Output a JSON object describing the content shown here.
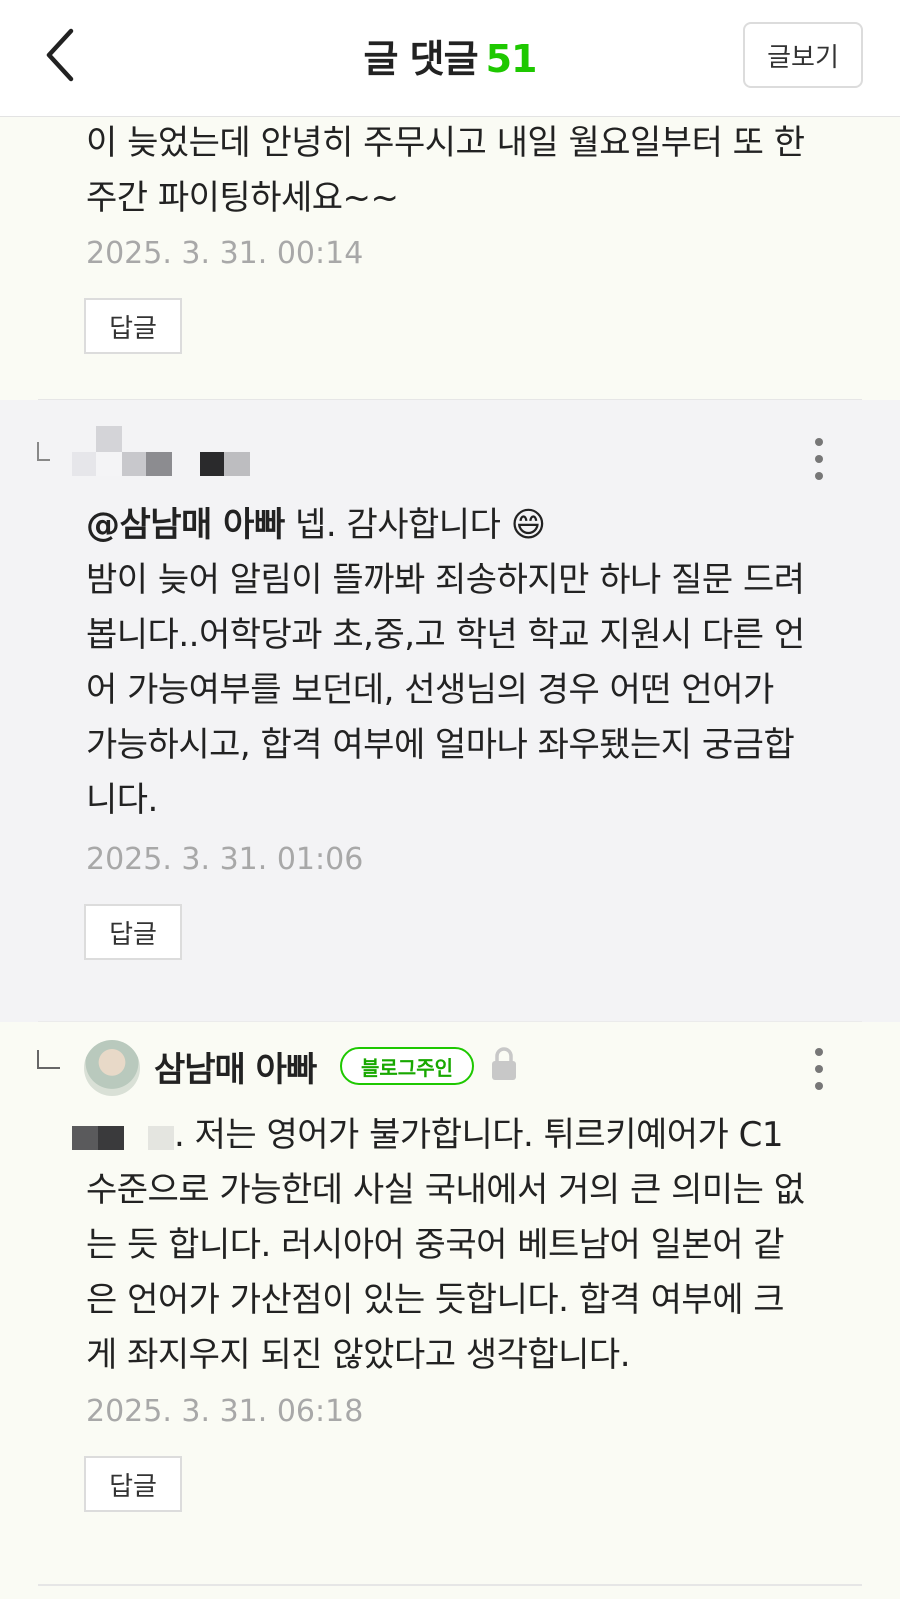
{
  "header": {
    "title": "글 댓글",
    "comment_count": "51",
    "view_post_label": "글보기",
    "accent_color": "#1ec800"
  },
  "comments": [
    {
      "lines": [
        "이 늦었는데 안녕히 주무시고 내일 월요일부터 또 한",
        "주간 파이팅하세요~~"
      ],
      "timestamp": "2025. 3. 31. 00:14",
      "reply_label": "답글"
    },
    {
      "mention": "@삼남매 아빠",
      "first_line_rest": " 넵. 감사합니다 😄",
      "lines": [
        "밤이 늦어 알림이 뜰까봐 죄송하지만 하나 질문 드려",
        "봅니다..어학당과 초,중,고 학년 학교 지원시 다른 언",
        "어 가능여부를 보던데, 선생님의 경우 어떤 언어가",
        "가능하시고, 합격 여부에 얼마나 좌우됐는지 궁금합",
        "니다."
      ],
      "timestamp": "2025. 3. 31. 01:06",
      "reply_label": "답글"
    },
    {
      "author": "삼남매 아빠",
      "badge": "블로그주인",
      "first_line_rest": ". 저는 영어가 불가합니다. 튀르키예어가 C1",
      "lines": [
        "수준으로 가능한데 사실 국내에서 거의 큰 의미는 없",
        "는 듯 합니다. 러시아어 중국어 베트남어 일본어 같",
        "은 언어가 가산점이 있는 듯합니다. 합격 여부에 크",
        "게 좌지우지 되진 않았다고 생각합니다."
      ],
      "timestamp": "2025. 3. 31. 06:18",
      "reply_label": "답글"
    }
  ]
}
